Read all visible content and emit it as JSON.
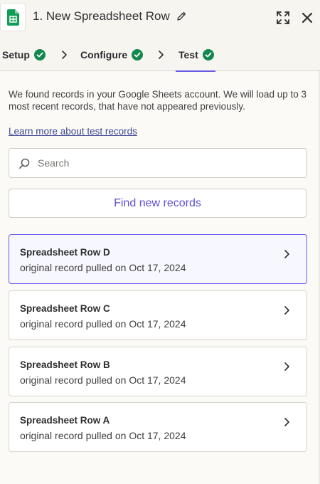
{
  "header": {
    "title": "1. New Spreadsheet Row",
    "app_icon": "google-sheets-icon",
    "actions": [
      "pencil-icon",
      "expand-icon",
      "close-icon"
    ]
  },
  "tabs": [
    {
      "label": "Setup",
      "status": "complete",
      "active": false
    },
    {
      "label": "Configure",
      "status": "complete",
      "active": false
    },
    {
      "label": "Test",
      "status": "complete",
      "active": true
    }
  ],
  "intro": {
    "text": "We found records in your Google Sheets account. We will load up to 3 most recent records, that have not appeared previously.",
    "link": "Learn more about test records"
  },
  "search": {
    "placeholder": "Search",
    "value": ""
  },
  "find_button": {
    "label": "Find new records"
  },
  "records": [
    {
      "title": "Spreadsheet Row D",
      "subtitle": "original record pulled on Oct 17, 2024",
      "selected": true
    },
    {
      "title": "Spreadsheet Row C",
      "subtitle": "original record pulled on Oct 17, 2024",
      "selected": false
    },
    {
      "title": "Spreadsheet Row B",
      "subtitle": "original record pulled on Oct 17, 2024",
      "selected": false
    },
    {
      "title": "Spreadsheet Row A",
      "subtitle": "original record pulled on Oct 17, 2024",
      "selected": false
    }
  ],
  "colors": {
    "accent": "#695be8",
    "success": "#13884e",
    "sheets_green": "#0f9d58",
    "background": "#fbfaf7"
  }
}
